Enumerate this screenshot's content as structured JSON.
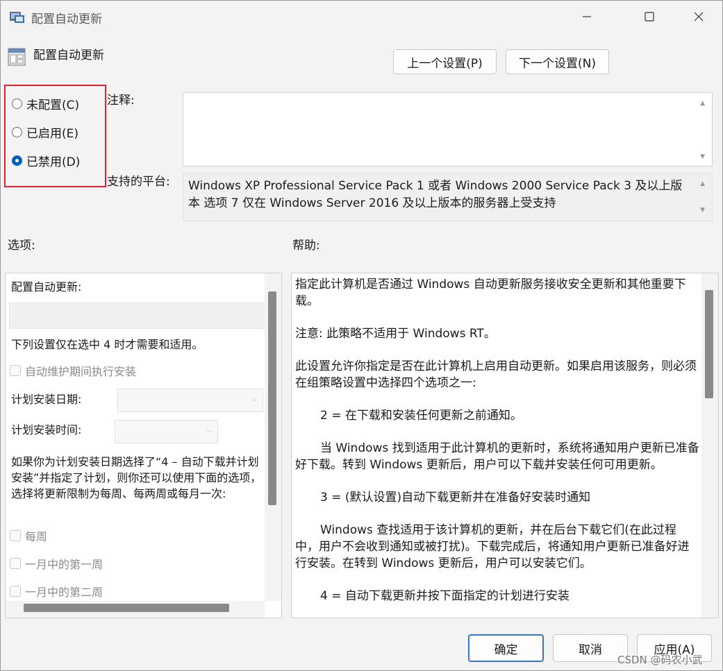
{
  "window": {
    "title": "配置自动更新",
    "minimize_icon": "minimize-icon",
    "maximize_icon": "maximize-icon",
    "close_icon": "close-icon"
  },
  "header": {
    "policy_title": "配置自动更新",
    "prev_button": "上一个设置(P)",
    "next_button": "下一个设置(N)"
  },
  "state": {
    "options": [
      {
        "label": "未配置(C)",
        "checked": false
      },
      {
        "label": "已启用(E)",
        "checked": false
      },
      {
        "label": "已禁用(D)",
        "checked": true
      }
    ],
    "highlight_color": "#e0202a"
  },
  "comment": {
    "label": "注释:",
    "value": ""
  },
  "platform": {
    "label": "支持的平台:",
    "text": "Windows XP Professional Service Pack 1 或者 Windows 2000 Service Pack 3 及以上版本 选项 7 仅在 Windows Server 2016 及以上版本的服务器上受支持"
  },
  "options_panel": {
    "heading": "选项:",
    "title": "配置自动更新:",
    "note": "下列设置仅在选中 4 时才需要和适用。",
    "auto_maintenance": "自动维护期间执行安装",
    "schedule_day_label": "计划安装日期:",
    "schedule_time_label": "计划安装时间:",
    "paragraph": "如果你为计划安装日期选择了“4 – 自动下载并计划安装”并指定了计划，则你还可以使用下面的选项，选择将更新限制为每周、每两周或每月一次:",
    "weekly": "每周",
    "first_week": "一月中的第一周",
    "second_week": "一月中的第二周"
  },
  "help_panel": {
    "heading": "帮助:",
    "paragraphs": [
      "指定此计算机是否通过 Windows 自动更新服务接收安全更新和其他重要下载。",
      "注意: 此策略不适用于 Windows RT。",
      "此设置允许你指定是否在此计算机上启用自动更新。如果启用该服务，则必须在组策略设置中选择四个选项之一:",
      "2 = 在下载和安装任何更新之前通知。",
      "当 Windows 找到适用于此计算机的更新时，系统将通知用户更新已准备好下载。转到 Windows 更新后，用户可以下载并安装任何可用更新。",
      "3 = (默认设置)自动下载更新并在准备好安装时通知",
      "Windows 查找适用于该计算机的更新，并在后台下载它们(在此过程中，用户不会收到通知或被打扰)。下载完成后，将通知用户更新已准备好进行安装。在转到 Windows 更新后，用户可以安装它们。",
      "4 = 自动下载更新并按下面指定的计划进行安装"
    ]
  },
  "footer": {
    "ok": "确定",
    "cancel": "取消",
    "apply": "应用(A)",
    "watermark": "CSDN @码农小武"
  }
}
